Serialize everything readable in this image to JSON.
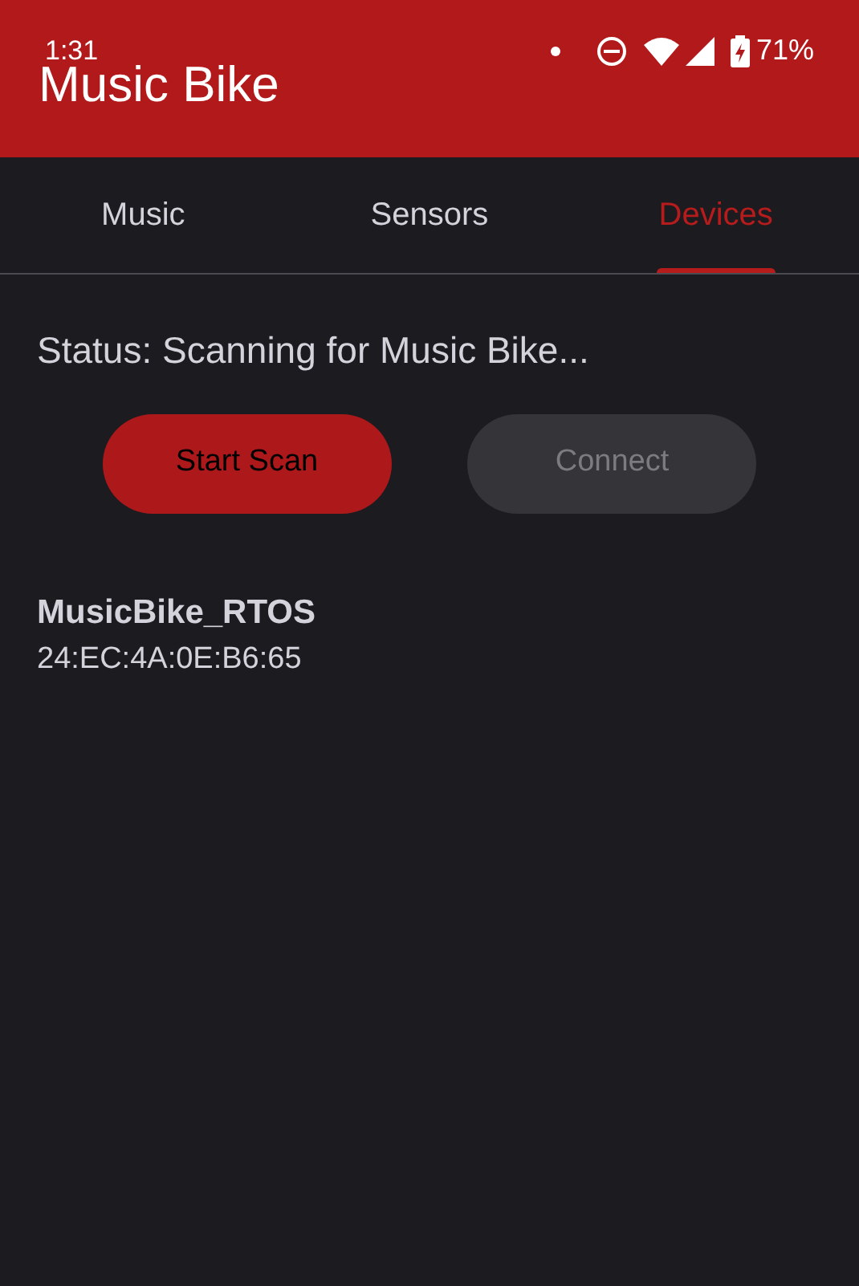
{
  "status_bar": {
    "time": "1:31",
    "battery": "71%"
  },
  "app_bar": {
    "title": "Music Bike"
  },
  "tabs": [
    {
      "label": "Music",
      "selected": false
    },
    {
      "label": "Sensors",
      "selected": false
    },
    {
      "label": "Devices",
      "selected": true
    }
  ],
  "status": "Status: Scanning for Music Bike...",
  "buttons": [
    {
      "label": "Start Scan",
      "disabled": false
    },
    {
      "label": "Connect",
      "disabled": true
    }
  ],
  "devices": [
    {
      "name": "MusicBike_RTOS",
      "address": "24:EC:4A:0E:B6:65"
    }
  ]
}
